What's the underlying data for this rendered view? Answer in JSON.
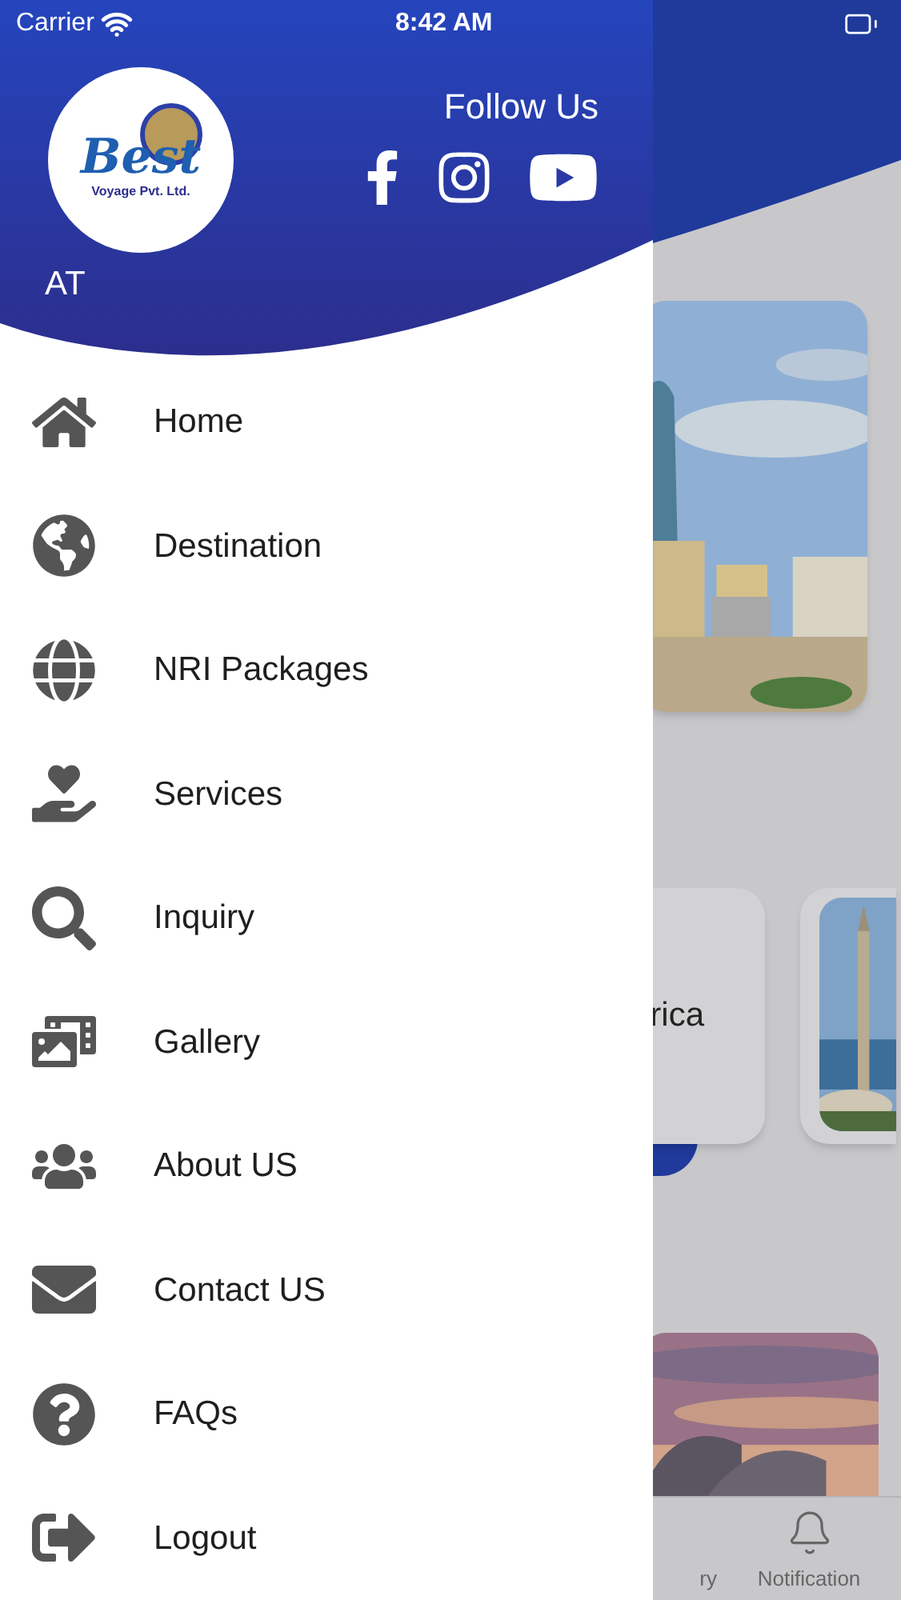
{
  "status_bar": {
    "carrier": "Carrier",
    "time": "8:42 AM"
  },
  "drawer": {
    "logo": {
      "name": "Best",
      "tagline": "Voyage Pvt. Ltd."
    },
    "user": "AT",
    "follow_title": "Follow Us",
    "items": [
      {
        "label": "Home"
      },
      {
        "label": "Destination"
      },
      {
        "label": "NRI Packages"
      },
      {
        "label": "Services"
      },
      {
        "label": "Inquiry"
      },
      {
        "label": "Gallery"
      },
      {
        "label": "About US"
      },
      {
        "label": "Contact US"
      },
      {
        "label": "FAQs"
      },
      {
        "label": "Logout"
      }
    ]
  },
  "background": {
    "card_text": "rica",
    "tab_bar": [
      {
        "label": "ry"
      },
      {
        "label": "Notification"
      }
    ]
  }
}
